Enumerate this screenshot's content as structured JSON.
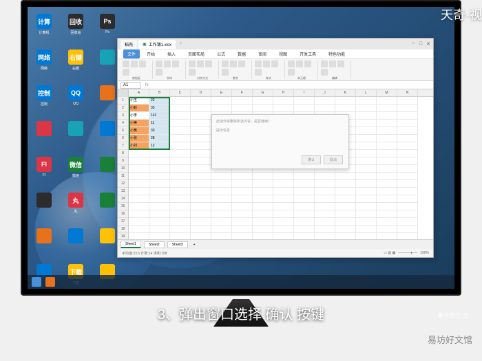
{
  "watermarks": {
    "top_right": "天奇·视",
    "bottom_right_1": "◉天奇生活",
    "bottom_right_2": "易坊好文馆"
  },
  "caption": "3、弹出窗口选择 确认 按键",
  "desktop": {
    "icons": [
      [
        {
          "label": "计算机",
          "color": "c-blue"
        },
        {
          "label": "回收站",
          "color": "c-dark"
        },
        {
          "label": "Ps",
          "color": "c-dark"
        }
      ],
      [
        {
          "label": "网络",
          "color": "c-blue"
        },
        {
          "label": "右键",
          "color": "c-yellow"
        },
        {
          "label": "",
          "color": "c-teal"
        }
      ],
      [
        {
          "label": "控制",
          "color": "c-blue"
        },
        {
          "label": "QQ",
          "color": "c-blue"
        },
        {
          "label": "",
          "color": "c-orange"
        }
      ],
      [
        {
          "label": "",
          "color": "c-red"
        },
        {
          "label": "",
          "color": "c-teal"
        },
        {
          "label": "",
          "color": "c-blue"
        }
      ],
      [
        {
          "label": "Fl",
          "color": "c-red"
        },
        {
          "label": "微信",
          "color": "c-green"
        },
        {
          "label": "",
          "color": "c-green"
        }
      ],
      [
        {
          "label": "",
          "color": "c-dark"
        },
        {
          "label": "丸",
          "color": "c-red"
        },
        {
          "label": "",
          "color": "c-green"
        }
      ],
      [
        {
          "label": "",
          "color": "c-orange"
        },
        {
          "label": "",
          "color": "c-blue"
        },
        {
          "label": "",
          "color": "c-yellow"
        }
      ],
      [
        {
          "label": "",
          "color": "c-blue"
        },
        {
          "label": "下载",
          "color": "c-yellow"
        },
        {
          "label": "",
          "color": "c-yellow"
        }
      ],
      [
        {
          "label": "",
          "color": "c-purple"
        },
        {
          "label": "",
          "color": "c-blue"
        }
      ]
    ]
  },
  "excel": {
    "tabs": [
      {
        "label": "稻壳",
        "active": false
      },
      {
        "label": "工作簿1.xlsx",
        "active": true
      }
    ],
    "menu": {
      "file": "文件",
      "items": [
        "开始",
        "插入",
        "页面布局",
        "公式",
        "数据",
        "审阅",
        "视图",
        "开发工具",
        "特色功能"
      ]
    },
    "toolgroups": [
      "剪贴板",
      "字体",
      "对齐方式",
      "数字",
      "样式",
      "单元格",
      "编辑"
    ],
    "cell_ref": "A1",
    "formula": "",
    "columns": [
      "A",
      "B",
      "C",
      "D",
      "E",
      "F",
      "G",
      "H",
      "I",
      "J",
      "K",
      "L",
      "M",
      "N"
    ],
    "rows": [
      "1",
      "2",
      "3",
      "4",
      "5",
      "6",
      "7",
      "8",
      "9",
      "10",
      "11",
      "12",
      "13",
      "14",
      "15",
      "16",
      "17",
      "18",
      "19"
    ],
    "data": [
      {
        "a": "小王",
        "b": "22"
      },
      {
        "a": "小赵",
        "b": "35"
      },
      {
        "a": "小李",
        "b": "141"
      },
      {
        "a": "小美",
        "b": "11"
      },
      {
        "a": "小吴",
        "b": "33"
      },
      {
        "a": "小张",
        "b": "28"
      },
      {
        "a": "小刘",
        "b": "12"
      }
    ],
    "dialog": {
      "text1": "此操作将删除所选内容，是否继续？",
      "text2": "提示信息",
      "ok": "确认",
      "cancel": "取消"
    },
    "sheet_tabs": [
      "Sheet1",
      "Sheet2",
      "Sheet3"
    ],
    "status": "平均值:23.5  计数:14  求和:158",
    "zoom": "100%"
  }
}
